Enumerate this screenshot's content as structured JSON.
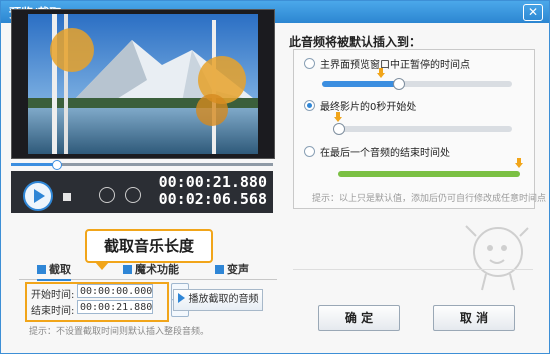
{
  "window": {
    "title": "预览/截取",
    "close_symbol": "✕"
  },
  "player": {
    "current_time": "00:00:21.880",
    "total_time": "00:02:06.568",
    "progress_fraction": 0.17
  },
  "callout": {
    "text": "截取音乐长度"
  },
  "tabs": [
    {
      "label": "截取",
      "active": true
    },
    {
      "label": "魔术功能",
      "active": false
    },
    {
      "label": "变声",
      "active": false
    }
  ],
  "clip": {
    "start_label": "开始时间:",
    "start_value": "00:00:00.000",
    "end_label": "结束时间:",
    "end_value": "00:00:21.880",
    "play_button": "播放截取的音频"
  },
  "tip_left": "提示：不设置截取时间则默认插入整段音频。",
  "insert": {
    "heading": "此音频将被默认插入到：",
    "options": [
      {
        "label": "主界面预览窗口中正暂停的时间点",
        "checked": false,
        "slider_fraction": 0.4,
        "fill_color": "#3b8ee0"
      },
      {
        "label": "最终影片的0秒开始处",
        "checked": true,
        "slider_fraction": 0.0,
        "fill_color": "#3b8ee0"
      },
      {
        "label": "在最后一个音频的结束时间处",
        "checked": false,
        "slider_fraction": 1.0,
        "fill_color": "#7bc043"
      }
    ],
    "hint": "提示：以上只是默认值，添加后仍可自行修改成任意时间点"
  },
  "buttons": {
    "ok": "确 定",
    "cancel": "取 消"
  },
  "colors": {
    "accent": "#2f86d6",
    "highlight": "#f1a51a",
    "titlebar": "#2c86d1"
  }
}
